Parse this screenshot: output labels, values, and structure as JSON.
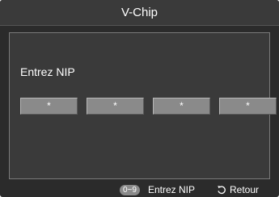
{
  "window": {
    "title": "V-Chip"
  },
  "pin_entry": {
    "prompt": "Entrez NIP",
    "digits": [
      "*",
      "*",
      "*",
      "*"
    ]
  },
  "footer": {
    "enter_key": "0~9",
    "enter_label": "Entrez NIP",
    "return_icon": "return-arrow-icon",
    "return_label": "Retour"
  },
  "colors": {
    "background": "#2b2b2b",
    "panel": "#3a3a3a",
    "pin_box": "#8a8a8a",
    "text": "#ffffff"
  }
}
